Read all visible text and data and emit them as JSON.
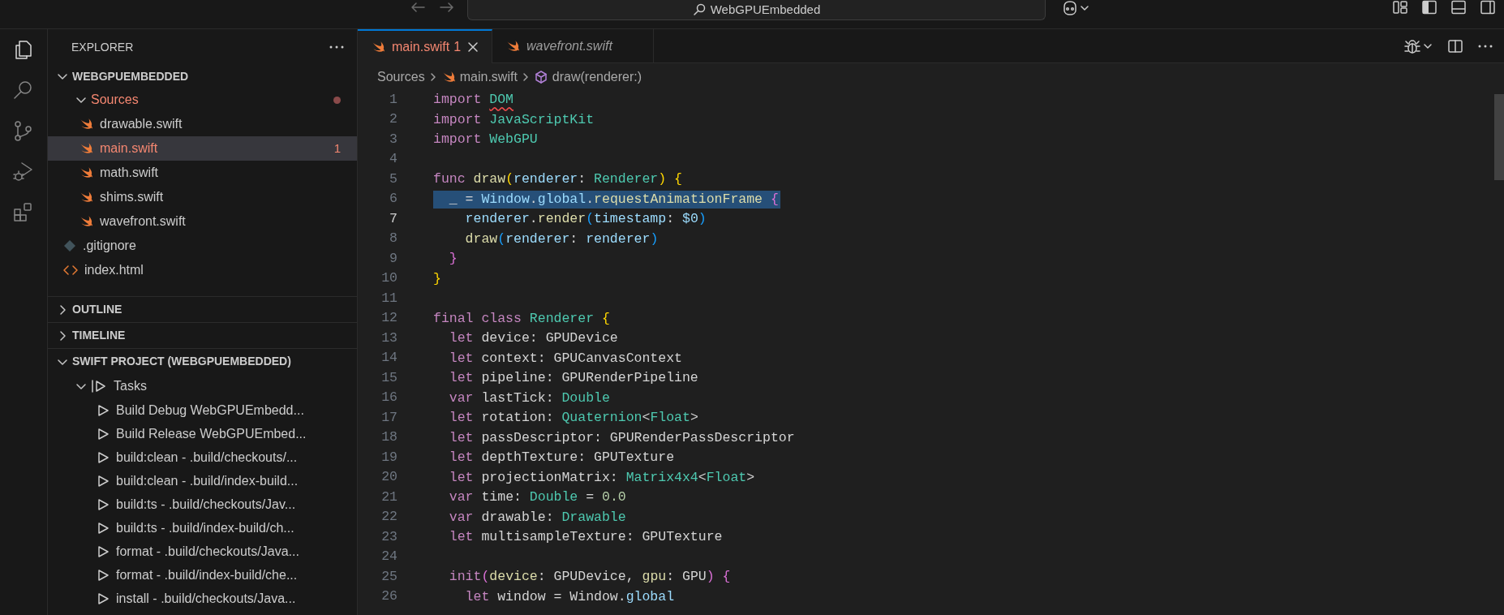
{
  "titlebar": {
    "search_text": "WebGPUEmbedded"
  },
  "activity_bar": [
    {
      "kind": "files",
      "selected": true
    },
    {
      "kind": "search",
      "selected": false
    },
    {
      "kind": "source_control",
      "selected": false
    },
    {
      "kind": "run_debug",
      "selected": false
    },
    {
      "kind": "extensions",
      "selected": false
    }
  ],
  "sidebar": {
    "title": "EXPLORER",
    "sections": [
      {
        "label": "WEBGPUEMBEDDED",
        "expanded": true,
        "items": [
          {
            "label": "Sources",
            "kind": "folder",
            "expanded": true,
            "error": true,
            "selected": false,
            "children": [
              {
                "label": "drawable.swift",
                "kind": "swift",
                "error": false,
                "selected": false
              },
              {
                "label": "main.swift",
                "kind": "swift",
                "error": true,
                "selected": true,
                "badge": "1"
              },
              {
                "label": "math.swift",
                "kind": "swift",
                "error": false,
                "selected": false
              },
              {
                "label": "shims.swift",
                "kind": "swift",
                "error": false,
                "selected": false
              },
              {
                "label": "wavefront.swift",
                "kind": "swift",
                "error": false,
                "selected": false
              }
            ]
          },
          {
            "label": ".gitignore",
            "kind": "git",
            "error": false,
            "selected": false
          },
          {
            "label": "index.html",
            "kind": "html",
            "error": false,
            "selected": false
          }
        ]
      },
      {
        "label": "OUTLINE",
        "expanded": false
      },
      {
        "label": "TIMELINE",
        "expanded": false
      },
      {
        "label": "SWIFT PROJECT (WEBGPUEMBEDDED)",
        "expanded": true,
        "items": [
          {
            "label": "Tasks",
            "kind": "tasks",
            "expanded": true,
            "error": false,
            "selected": false,
            "children": [
              {
                "label": "Build Debug WebGPUEmbedd...",
                "kind": "task",
                "error": false,
                "selected": false
              },
              {
                "label": "Build Release WebGPUEmbed...",
                "kind": "task",
                "error": false,
                "selected": false
              },
              {
                "label": "build:clean - .build/checkouts/...",
                "kind": "task",
                "error": false,
                "selected": false
              },
              {
                "label": "build:clean - .build/index-build...",
                "kind": "task",
                "error": false,
                "selected": false
              },
              {
                "label": "build:ts - .build/checkouts/Jav...",
                "kind": "task",
                "error": false,
                "selected": false
              },
              {
                "label": "build:ts - .build/index-build/ch...",
                "kind": "task",
                "error": false,
                "selected": false
              },
              {
                "label": "format - .build/checkouts/Java...",
                "kind": "task",
                "error": false,
                "selected": false
              },
              {
                "label": "format - .build/index-build/che...",
                "kind": "task",
                "error": false,
                "selected": false
              },
              {
                "label": "install - .build/checkouts/Java...",
                "kind": "task",
                "error": false,
                "selected": false
              }
            ]
          }
        ]
      }
    ]
  },
  "tabs": [
    {
      "label": "main.swift",
      "badge": "1",
      "error": true,
      "preview": false,
      "selected": true
    },
    {
      "label": "wavefront.swift",
      "error": false,
      "preview": true,
      "selected": false
    }
  ],
  "breadcrumbs": [
    {
      "text": "Sources",
      "kind": "folder"
    },
    {
      "text": "main.swift",
      "kind": "swift"
    },
    {
      "text": "draw(renderer:)",
      "kind": "symbol"
    }
  ],
  "editor": {
    "lines": [
      {
        "number": "1",
        "current": false,
        "tokens": [
          {
            "text": "import ",
            "kind": "kw"
          },
          {
            "text": "DOM",
            "kind": "type_error"
          }
        ]
      },
      {
        "number": "2",
        "current": false,
        "tokens": [
          {
            "text": "import ",
            "kind": "kw"
          },
          {
            "text": "JavaScriptKit",
            "kind": "type"
          }
        ]
      },
      {
        "number": "3",
        "current": false,
        "tokens": [
          {
            "text": "import ",
            "kind": "kw"
          },
          {
            "text": "WebGPU",
            "kind": "type"
          }
        ]
      },
      {
        "number": "4",
        "current": false
      },
      {
        "number": "5",
        "current": false,
        "tokens": [
          {
            "text": "func ",
            "kind": "kw"
          },
          {
            "text": "draw",
            "kind": "fn"
          },
          {
            "text": "(",
            "kind": "b1"
          },
          {
            "text": "renderer",
            "kind": "var"
          },
          {
            "text": ": ",
            "kind": "plain"
          },
          {
            "text": "Renderer",
            "kind": "type"
          },
          {
            "text": ")",
            "kind": "b1"
          },
          {
            "text": " {",
            "kind": "b1"
          }
        ]
      },
      {
        "number": "6",
        "selected": true,
        "current": false,
        "tokens": [
          {
            "text": "  _ = ",
            "kind": "plain"
          },
          {
            "text": "Window",
            "kind": "var"
          },
          {
            "text": ".",
            "kind": "plain"
          },
          {
            "text": "global",
            "kind": "var"
          },
          {
            "text": ".",
            "kind": "plain"
          },
          {
            "text": "requestAnimationFrame",
            "kind": "fn"
          },
          {
            "text": " {",
            "kind": "b2"
          }
        ]
      },
      {
        "number": "7",
        "current": true,
        "tokens": [
          {
            "text": "    renderer",
            "kind": "var"
          },
          {
            "text": ".",
            "kind": "plain"
          },
          {
            "text": "render",
            "kind": "fn"
          },
          {
            "text": "(",
            "kind": "b3"
          },
          {
            "text": "timestamp",
            "kind": "var"
          },
          {
            "text": ": ",
            "kind": "plain"
          },
          {
            "text": "$0",
            "kind": "var"
          },
          {
            "text": ")",
            "kind": "b3"
          }
        ]
      },
      {
        "number": "8",
        "current": false,
        "tokens": [
          {
            "text": "    draw",
            "kind": "fn"
          },
          {
            "text": "(",
            "kind": "b3"
          },
          {
            "text": "renderer",
            "kind": "var"
          },
          {
            "text": ": ",
            "kind": "plain"
          },
          {
            "text": "renderer",
            "kind": "var"
          },
          {
            "text": ")",
            "kind": "b3"
          }
        ]
      },
      {
        "number": "9",
        "current": false,
        "tokens": [
          {
            "text": "  }",
            "kind": "b2"
          }
        ]
      },
      {
        "number": "10",
        "current": false,
        "tokens": [
          {
            "text": "}",
            "kind": "b1"
          }
        ]
      },
      {
        "number": "11",
        "current": false
      },
      {
        "number": "12",
        "current": false,
        "tokens": [
          {
            "text": "final class ",
            "kind": "kw"
          },
          {
            "text": "Renderer",
            "kind": "type"
          },
          {
            "text": " {",
            "kind": "b1"
          }
        ]
      },
      {
        "number": "13",
        "current": false,
        "tokens": [
          {
            "text": "  let ",
            "kind": "kw"
          },
          {
            "text": "device: GPUDevice",
            "kind": "plain"
          }
        ]
      },
      {
        "number": "14",
        "current": false,
        "tokens": [
          {
            "text": "  let ",
            "kind": "kw"
          },
          {
            "text": "context: GPUCanvasContext",
            "kind": "plain"
          }
        ]
      },
      {
        "number": "15",
        "current": false,
        "tokens": [
          {
            "text": "  let ",
            "kind": "kw"
          },
          {
            "text": "pipeline: GPURenderPipeline",
            "kind": "plain"
          }
        ]
      },
      {
        "number": "16",
        "current": false,
        "tokens": [
          {
            "text": "  var ",
            "kind": "kw"
          },
          {
            "text": "lastTick: ",
            "kind": "plain"
          },
          {
            "text": "Double",
            "kind": "type"
          }
        ]
      },
      {
        "number": "17",
        "current": false,
        "tokens": [
          {
            "text": "  let ",
            "kind": "kw"
          },
          {
            "text": "rotation: ",
            "kind": "plain"
          },
          {
            "text": "Quaternion",
            "kind": "type"
          },
          {
            "text": "<",
            "kind": "plain"
          },
          {
            "text": "Float",
            "kind": "type"
          },
          {
            "text": ">",
            "kind": "plain"
          }
        ]
      },
      {
        "number": "18",
        "current": false,
        "tokens": [
          {
            "text": "  let ",
            "kind": "kw"
          },
          {
            "text": "passDescriptor: GPURenderPassDescriptor",
            "kind": "plain"
          }
        ]
      },
      {
        "number": "19",
        "current": false,
        "tokens": [
          {
            "text": "  let ",
            "kind": "kw"
          },
          {
            "text": "depthTexture: GPUTexture",
            "kind": "plain"
          }
        ]
      },
      {
        "number": "20",
        "current": false,
        "tokens": [
          {
            "text": "  let ",
            "kind": "kw"
          },
          {
            "text": "projectionMatrix: ",
            "kind": "plain"
          },
          {
            "text": "Matrix4x4",
            "kind": "type"
          },
          {
            "text": "<",
            "kind": "plain"
          },
          {
            "text": "Float",
            "kind": "type"
          },
          {
            "text": ">",
            "kind": "plain"
          }
        ]
      },
      {
        "number": "21",
        "current": false,
        "tokens": [
          {
            "text": "  var ",
            "kind": "kw"
          },
          {
            "text": "time: ",
            "kind": "plain"
          },
          {
            "text": "Double",
            "kind": "type"
          },
          {
            "text": " = ",
            "kind": "plain"
          },
          {
            "text": "0.0",
            "kind": "num"
          }
        ]
      },
      {
        "number": "22",
        "current": false,
        "tokens": [
          {
            "text": "  var ",
            "kind": "kw"
          },
          {
            "text": "drawable: ",
            "kind": "plain"
          },
          {
            "text": "Drawable",
            "kind": "type"
          }
        ]
      },
      {
        "number": "23",
        "current": false,
        "tokens": [
          {
            "text": "  let ",
            "kind": "kw"
          },
          {
            "text": "multisampleTexture: GPUTexture",
            "kind": "plain"
          }
        ]
      },
      {
        "number": "24",
        "current": false
      },
      {
        "number": "25",
        "current": false,
        "tokens": [
          {
            "text": "  init",
            "kind": "kw"
          },
          {
            "text": "(",
            "kind": "b2"
          },
          {
            "text": "device",
            "kind": "fn"
          },
          {
            "text": ": GPUDevice, ",
            "kind": "plain"
          },
          {
            "text": "gpu",
            "kind": "fn"
          },
          {
            "text": ": GPU",
            "kind": "plain"
          },
          {
            "text": ")",
            "kind": "b2"
          },
          {
            "text": " {",
            "kind": "b2"
          }
        ]
      },
      {
        "number": "26",
        "current": false,
        "tokens": [
          {
            "text": "    let ",
            "kind": "kw"
          },
          {
            "text": "window = Window.",
            "kind": "plain"
          },
          {
            "text": "global",
            "kind": "var"
          }
        ]
      }
    ]
  }
}
